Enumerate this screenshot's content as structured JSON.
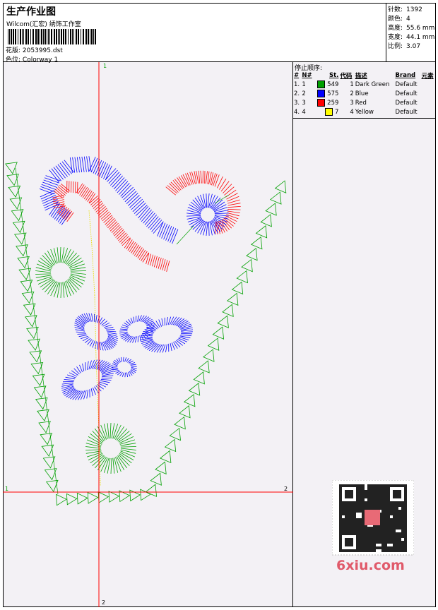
{
  "header": {
    "title": "生产作业图",
    "company": "Wilcom(汇宏) 绣饰工作室",
    "file_label": "花版:",
    "file_value": "2053995.dst",
    "colorway_label": "色位:",
    "colorway_value": "Colorway 1"
  },
  "stats": [
    {
      "label": "针数:",
      "value": "1392"
    },
    {
      "label": "颜色:",
      "value": "4"
    },
    {
      "label": "高度:",
      "value": "55.6 mm"
    },
    {
      "label": "宽度:",
      "value": "44.1 mm"
    },
    {
      "label": "比例:",
      "value": "3.07"
    }
  ],
  "stop_sequence": {
    "title": "停止顺序:",
    "columns": [
      "#",
      "N#",
      "St.",
      "代码",
      "描述",
      "Brand",
      "元素"
    ],
    "rows": [
      {
        "num": "1.",
        "n": "1",
        "color": "#00a000",
        "st": "549",
        "code": "1",
        "desc": "Dark Green",
        "brand": "Default"
      },
      {
        "num": "2.",
        "n": "2",
        "color": "#0000ff",
        "st": "575",
        "code": "2",
        "desc": "Blue",
        "brand": "Default"
      },
      {
        "num": "3.",
        "n": "3",
        "color": "#ff0000",
        "st": "259",
        "code": "3",
        "desc": "Red",
        "brand": "Default"
      },
      {
        "num": "4.",
        "n": "4",
        "color": "#ffff00",
        "st": "7",
        "code": "4",
        "desc": "Yellow",
        "brand": "Default"
      }
    ]
  },
  "axis_labels": {
    "top": "1",
    "bottom": "2",
    "left": "1",
    "right": "2"
  },
  "colors": {
    "green": "#00a000",
    "blue": "#0000ff",
    "red": "#ff0000",
    "yellow": "#e8e000",
    "axis": "#ff0000"
  },
  "watermark": {
    "site": "6xiu.com"
  }
}
